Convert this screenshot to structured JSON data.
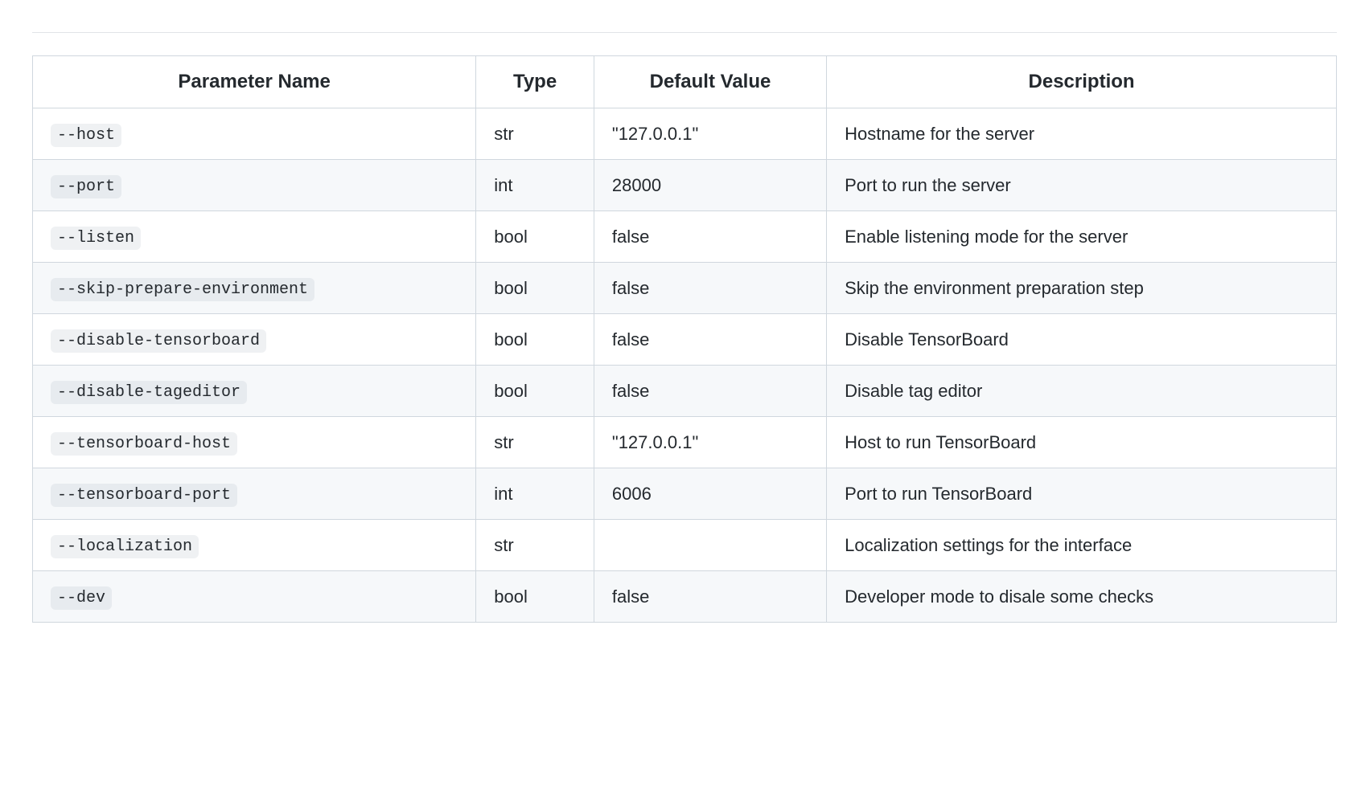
{
  "table": {
    "headers": {
      "param": "Parameter Name",
      "type": "Type",
      "default": "Default Value",
      "desc": "Description"
    },
    "rows": [
      {
        "param": "--host",
        "type": "str",
        "default": "\"127.0.0.1\"",
        "desc": "Hostname for the server"
      },
      {
        "param": "--port",
        "type": "int",
        "default": "28000",
        "desc": "Port to run the server"
      },
      {
        "param": "--listen",
        "type": "bool",
        "default": "false",
        "desc": "Enable listening mode for the server"
      },
      {
        "param": "--skip-prepare-environment",
        "type": "bool",
        "default": "false",
        "desc": "Skip the environment preparation step"
      },
      {
        "param": "--disable-tensorboard",
        "type": "bool",
        "default": "false",
        "desc": "Disable TensorBoard"
      },
      {
        "param": "--disable-tageditor",
        "type": "bool",
        "default": "false",
        "desc": "Disable tag editor"
      },
      {
        "param": "--tensorboard-host",
        "type": "str",
        "default": "\"127.0.0.1\"",
        "desc": "Host to run TensorBoard"
      },
      {
        "param": "--tensorboard-port",
        "type": "int",
        "default": "6006",
        "desc": "Port to run TensorBoard"
      },
      {
        "param": "--localization",
        "type": "str",
        "default": "",
        "desc": "Localization settings for the interface"
      },
      {
        "param": "--dev",
        "type": "bool",
        "default": "false",
        "desc": "Developer mode to disale some checks"
      }
    ]
  }
}
